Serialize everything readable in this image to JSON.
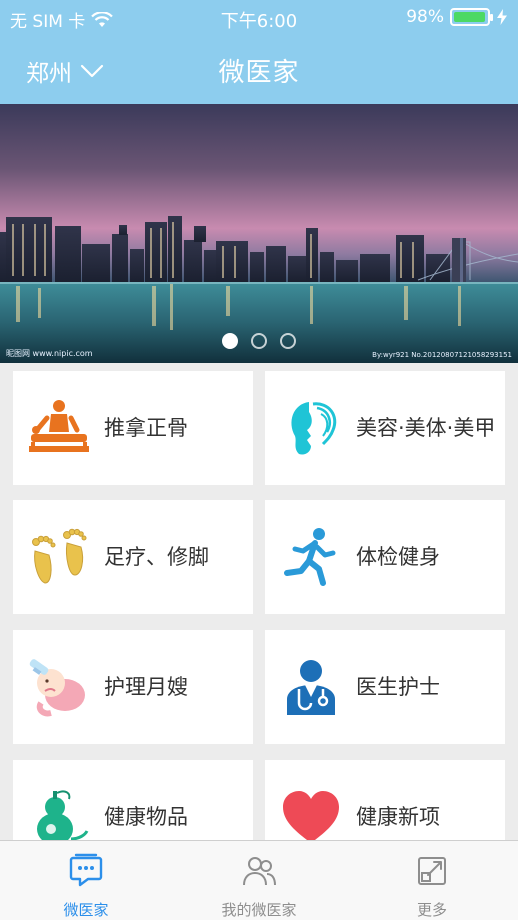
{
  "status_bar": {
    "carrier": "无 SIM 卡",
    "time": "下午6:00",
    "battery_percent": "98%",
    "battery_level": 0.98,
    "battery_color": "#4cd964"
  },
  "nav": {
    "city": "郑州",
    "title": "微医家",
    "background_color": "#8dcdee"
  },
  "banner": {
    "watermark_left": "昵图网 www.nipic.com",
    "watermark_right": "By:wyr921 No.20120807121058293151",
    "page_count": 3,
    "active_page": 1
  },
  "services": [
    {
      "label": "推拿正骨",
      "icon": "massage-icon"
    },
    {
      "label": "美容·美体·美甲",
      "icon": "beauty-face-icon"
    },
    {
      "label": "足疗、修脚",
      "icon": "footprints-icon"
    },
    {
      "label": "体检健身",
      "icon": "running-man-icon"
    },
    {
      "label": "护理月嫂",
      "icon": "baby-bottle-icon"
    },
    {
      "label": "医生护士",
      "icon": "doctor-icon"
    },
    {
      "label": "健康物品",
      "icon": "gourd-icon"
    },
    {
      "label": "健康新项",
      "icon": "heart-icon"
    }
  ],
  "tabs": [
    {
      "label": "微医家",
      "icon": "chat-bubble-icon",
      "active": true
    },
    {
      "label": "我的微医家",
      "icon": "users-icon",
      "active": false
    },
    {
      "label": "更多",
      "icon": "external-link-icon",
      "active": false
    }
  ],
  "colors": {
    "accent": "#2c8fea",
    "tab_inactive": "#8e8e8e"
  }
}
